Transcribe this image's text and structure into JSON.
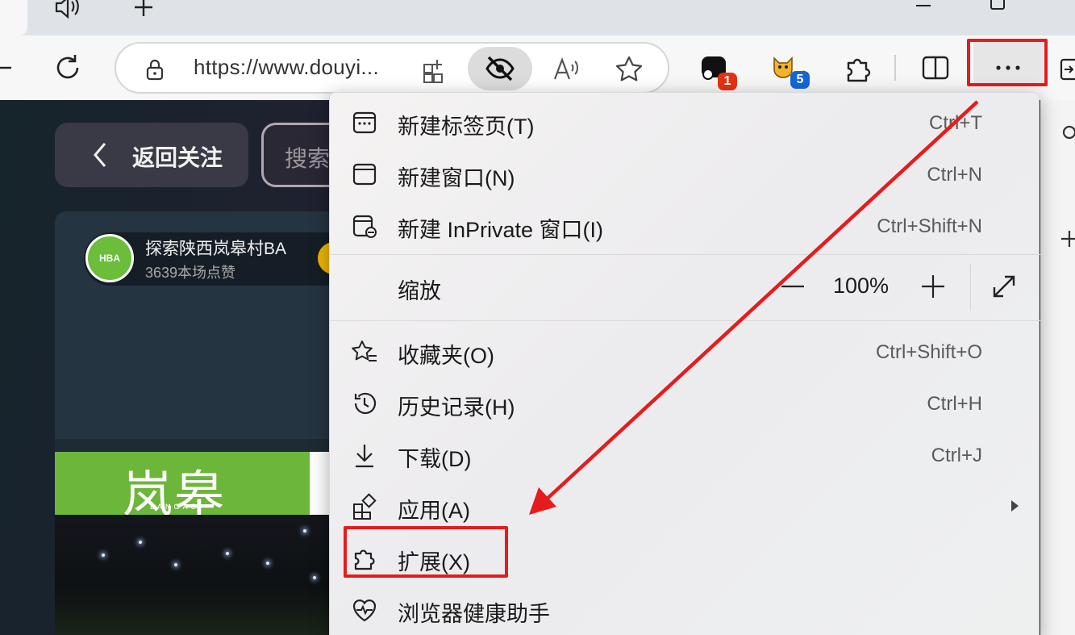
{
  "address_bar": {
    "url": "https://www.douyi..."
  },
  "extensions": {
    "badge1": "1",
    "badge2": "5"
  },
  "page": {
    "back_follow_label": "返回关注",
    "search_partial": "搜索",
    "live": {
      "name": "探索陕西岚皋村BA",
      "likes": "3639本场点赞",
      "avatar_text": "HBA"
    },
    "banner": {
      "text": "岚皋",
      "sub": "LANGAO"
    }
  },
  "menu": {
    "items": [
      {
        "label": "新建标签页(T)",
        "shortcut": "Ctrl+T",
        "icon": "new-tab-icon"
      },
      {
        "label": "新建窗口(N)",
        "shortcut": "Ctrl+N",
        "icon": "new-window-icon"
      },
      {
        "label": "新建 InPrivate 窗口(I)",
        "shortcut": "Ctrl+Shift+N",
        "icon": "inprivate-icon"
      },
      {
        "label": "收藏夹(O)",
        "shortcut": "Ctrl+Shift+O",
        "icon": "favorites-icon"
      },
      {
        "label": "历史记录(H)",
        "shortcut": "Ctrl+H",
        "icon": "history-icon"
      },
      {
        "label": "下载(D)",
        "shortcut": "Ctrl+J",
        "icon": "download-icon"
      },
      {
        "label": "应用(A)",
        "shortcut": "",
        "icon": "apps-icon"
      },
      {
        "label": "扩展(X)",
        "shortcut": "",
        "icon": "extensions-icon"
      },
      {
        "label": "浏览器健康助手",
        "shortcut": "",
        "icon": "health-icon"
      }
    ],
    "zoom": {
      "label": "缩放",
      "value": "100%"
    }
  },
  "colors": {
    "highlight": "#e51c1c",
    "menu_bg": "#f0eff0",
    "page_bg": "#1e2230"
  }
}
